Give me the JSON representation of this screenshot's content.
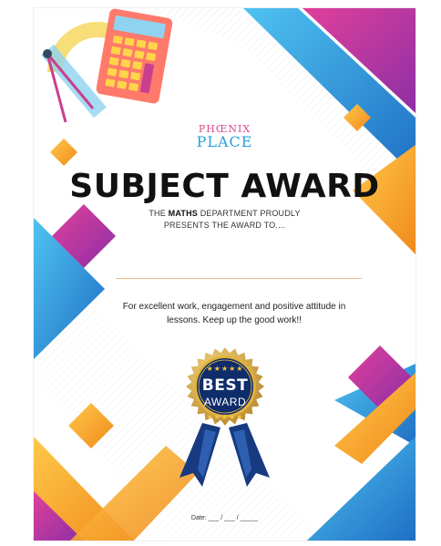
{
  "logo": {
    "line1": "PHŒNIX",
    "line2": "PLACE"
  },
  "title": "SUBJECT AWARD",
  "subtitle": {
    "prefix": "THE ",
    "subject": "MATHS",
    "suffix": " DEPARTMENT PROUDLY",
    "line2": "PRESENTS THE AWARD TO...."
  },
  "body_text": {
    "line1": "For excellent work, engagement and positive attitude in",
    "line2": "lessons. Keep up the good work!!"
  },
  "medal": {
    "top": "BEST",
    "bottom": "AWARD",
    "stars": "★★★★★"
  },
  "date_label": "Date: ___ / ___ / _____",
  "colors": {
    "blue": "#2a9fd8",
    "magenta": "#c53aa5",
    "orange": "#f7a928",
    "navy": "#0f2c6b",
    "gold": "#e2b23b"
  },
  "icons": [
    "calculator-icon",
    "compass-icon",
    "protractor-icon",
    "ruler-icon"
  ]
}
